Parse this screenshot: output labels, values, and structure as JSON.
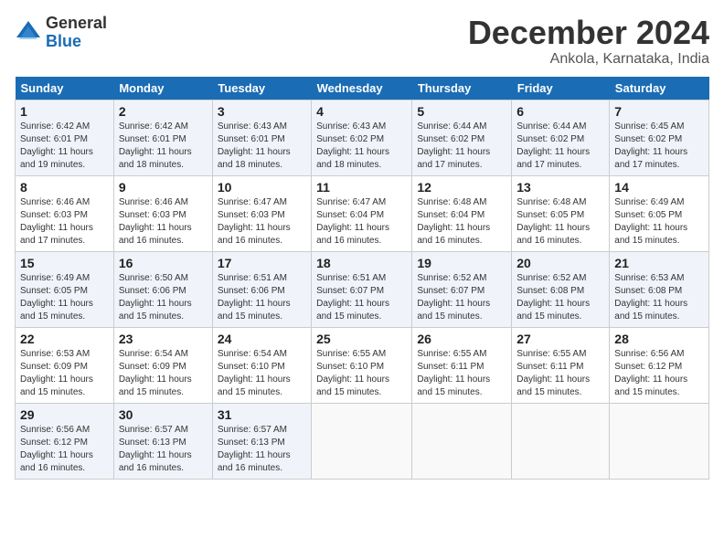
{
  "header": {
    "logo_general": "General",
    "logo_blue": "Blue",
    "month_title": "December 2024",
    "subtitle": "Ankola, Karnataka, India"
  },
  "calendar": {
    "days_of_week": [
      "Sunday",
      "Monday",
      "Tuesday",
      "Wednesday",
      "Thursday",
      "Friday",
      "Saturday"
    ],
    "weeks": [
      [
        {
          "day": "",
          "info": ""
        },
        {
          "day": "2",
          "info": "Sunrise: 6:42 AM\nSunset: 6:01 PM\nDaylight: 11 hours\nand 18 minutes."
        },
        {
          "day": "3",
          "info": "Sunrise: 6:43 AM\nSunset: 6:01 PM\nDaylight: 11 hours\nand 18 minutes."
        },
        {
          "day": "4",
          "info": "Sunrise: 6:43 AM\nSunset: 6:02 PM\nDaylight: 11 hours\nand 18 minutes."
        },
        {
          "day": "5",
          "info": "Sunrise: 6:44 AM\nSunset: 6:02 PM\nDaylight: 11 hours\nand 17 minutes."
        },
        {
          "day": "6",
          "info": "Sunrise: 6:44 AM\nSunset: 6:02 PM\nDaylight: 11 hours\nand 17 minutes."
        },
        {
          "day": "7",
          "info": "Sunrise: 6:45 AM\nSunset: 6:02 PM\nDaylight: 11 hours\nand 17 minutes."
        }
      ],
      [
        {
          "day": "8",
          "info": "Sunrise: 6:46 AM\nSunset: 6:03 PM\nDaylight: 11 hours\nand 17 minutes."
        },
        {
          "day": "9",
          "info": "Sunrise: 6:46 AM\nSunset: 6:03 PM\nDaylight: 11 hours\nand 16 minutes."
        },
        {
          "day": "10",
          "info": "Sunrise: 6:47 AM\nSunset: 6:03 PM\nDaylight: 11 hours\nand 16 minutes."
        },
        {
          "day": "11",
          "info": "Sunrise: 6:47 AM\nSunset: 6:04 PM\nDaylight: 11 hours\nand 16 minutes."
        },
        {
          "day": "12",
          "info": "Sunrise: 6:48 AM\nSunset: 6:04 PM\nDaylight: 11 hours\nand 16 minutes."
        },
        {
          "day": "13",
          "info": "Sunrise: 6:48 AM\nSunset: 6:05 PM\nDaylight: 11 hours\nand 16 minutes."
        },
        {
          "day": "14",
          "info": "Sunrise: 6:49 AM\nSunset: 6:05 PM\nDaylight: 11 hours\nand 15 minutes."
        }
      ],
      [
        {
          "day": "15",
          "info": "Sunrise: 6:49 AM\nSunset: 6:05 PM\nDaylight: 11 hours\nand 15 minutes."
        },
        {
          "day": "16",
          "info": "Sunrise: 6:50 AM\nSunset: 6:06 PM\nDaylight: 11 hours\nand 15 minutes."
        },
        {
          "day": "17",
          "info": "Sunrise: 6:51 AM\nSunset: 6:06 PM\nDaylight: 11 hours\nand 15 minutes."
        },
        {
          "day": "18",
          "info": "Sunrise: 6:51 AM\nSunset: 6:07 PM\nDaylight: 11 hours\nand 15 minutes."
        },
        {
          "day": "19",
          "info": "Sunrise: 6:52 AM\nSunset: 6:07 PM\nDaylight: 11 hours\nand 15 minutes."
        },
        {
          "day": "20",
          "info": "Sunrise: 6:52 AM\nSunset: 6:08 PM\nDaylight: 11 hours\nand 15 minutes."
        },
        {
          "day": "21",
          "info": "Sunrise: 6:53 AM\nSunset: 6:08 PM\nDaylight: 11 hours\nand 15 minutes."
        }
      ],
      [
        {
          "day": "22",
          "info": "Sunrise: 6:53 AM\nSunset: 6:09 PM\nDaylight: 11 hours\nand 15 minutes."
        },
        {
          "day": "23",
          "info": "Sunrise: 6:54 AM\nSunset: 6:09 PM\nDaylight: 11 hours\nand 15 minutes."
        },
        {
          "day": "24",
          "info": "Sunrise: 6:54 AM\nSunset: 6:10 PM\nDaylight: 11 hours\nand 15 minutes."
        },
        {
          "day": "25",
          "info": "Sunrise: 6:55 AM\nSunset: 6:10 PM\nDaylight: 11 hours\nand 15 minutes."
        },
        {
          "day": "26",
          "info": "Sunrise: 6:55 AM\nSunset: 6:11 PM\nDaylight: 11 hours\nand 15 minutes."
        },
        {
          "day": "27",
          "info": "Sunrise: 6:55 AM\nSunset: 6:11 PM\nDaylight: 11 hours\nand 15 minutes."
        },
        {
          "day": "28",
          "info": "Sunrise: 6:56 AM\nSunset: 6:12 PM\nDaylight: 11 hours\nand 15 minutes."
        }
      ],
      [
        {
          "day": "29",
          "info": "Sunrise: 6:56 AM\nSunset: 6:12 PM\nDaylight: 11 hours\nand 16 minutes."
        },
        {
          "day": "30",
          "info": "Sunrise: 6:57 AM\nSunset: 6:13 PM\nDaylight: 11 hours\nand 16 minutes."
        },
        {
          "day": "31",
          "info": "Sunrise: 6:57 AM\nSunset: 6:13 PM\nDaylight: 11 hours\nand 16 minutes."
        },
        {
          "day": "",
          "info": ""
        },
        {
          "day": "",
          "info": ""
        },
        {
          "day": "",
          "info": ""
        },
        {
          "day": "",
          "info": ""
        }
      ]
    ],
    "week0_day1": {
      "day": "1",
      "info": "Sunrise: 6:42 AM\nSunset: 6:01 PM\nDaylight: 11 hours\nand 19 minutes."
    }
  }
}
